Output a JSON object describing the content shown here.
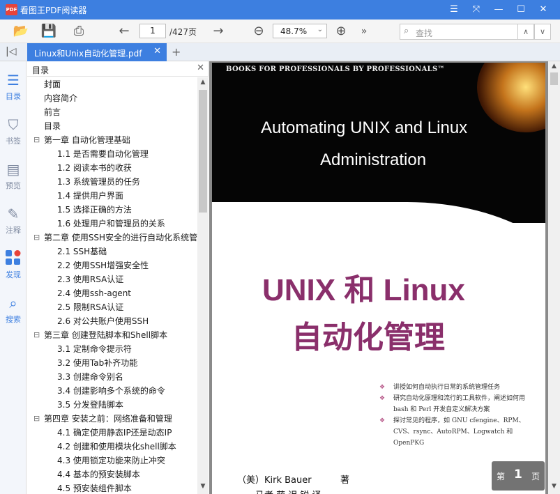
{
  "window": {
    "title": "看图王PDF阅读器",
    "logo_text": "PDF"
  },
  "toolbar": {
    "page_current": "1",
    "page_total": "/427页",
    "zoom": "48.7%",
    "search_placeholder": "查找"
  },
  "tabs": [
    {
      "label": "Linux和Unix自动化管理.pdf"
    }
  ],
  "rail": [
    {
      "label": "目录",
      "icon": "list-icon"
    },
    {
      "label": "书签",
      "icon": "bookmark-icon"
    },
    {
      "label": "预览",
      "icon": "preview-icon"
    },
    {
      "label": "注释",
      "icon": "note-icon"
    },
    {
      "label": "发现",
      "icon": "apps-icon"
    },
    {
      "label": "搜索",
      "icon": "search-icon"
    }
  ],
  "toc": {
    "title": "目录",
    "items": [
      {
        "label": "封面",
        "level": 0,
        "expandable": false
      },
      {
        "label": "内容简介",
        "level": 0,
        "expandable": false
      },
      {
        "label": "前言",
        "level": 0,
        "expandable": false
      },
      {
        "label": "目录",
        "level": 0,
        "expandable": false
      },
      {
        "label": "第一章 自动化管理基础",
        "level": 0,
        "expandable": true
      },
      {
        "label": "1.1 是否需要自动化管理",
        "level": 1,
        "expandable": false
      },
      {
        "label": "1.2 阅读本书的收获",
        "level": 1,
        "expandable": false
      },
      {
        "label": "1.3 系统管理员的任务",
        "level": 1,
        "expandable": false
      },
      {
        "label": "1.4 提供用户界面",
        "level": 1,
        "expandable": false
      },
      {
        "label": "1.5 选择正确的方法",
        "level": 1,
        "expandable": false
      },
      {
        "label": "1.6 处理用户和管理员的关系",
        "level": 1,
        "expandable": false
      },
      {
        "label": "第二章 使用SSH安全的进行自动化系统管",
        "level": 0,
        "expandable": true
      },
      {
        "label": "2.1 SSH基础",
        "level": 1,
        "expandable": false
      },
      {
        "label": "2.2 使用SSH增强安全性",
        "level": 1,
        "expandable": false
      },
      {
        "label": "2.3 使用RSA认证",
        "level": 1,
        "expandable": false
      },
      {
        "label": "2.4 使用ssh-agent",
        "level": 1,
        "expandable": false
      },
      {
        "label": "2.5 限制RSA认证",
        "level": 1,
        "expandable": false
      },
      {
        "label": "2.6 对公共账户使用SSH",
        "level": 1,
        "expandable": false
      },
      {
        "label": "第三章 创建登陆脚本和Shell脚本",
        "level": 0,
        "expandable": true
      },
      {
        "label": "3.1 定制命令提示符",
        "level": 1,
        "expandable": false
      },
      {
        "label": "3.2 使用Tab补齐功能",
        "level": 1,
        "expandable": false
      },
      {
        "label": "3.3 创建命令别名",
        "level": 1,
        "expandable": false
      },
      {
        "label": "3.4 创建影响多个系统的命令",
        "level": 1,
        "expandable": false
      },
      {
        "label": "3.5 分发登陆脚本",
        "level": 1,
        "expandable": false
      },
      {
        "label": "第四章 安装之前：网络准备和管理",
        "level": 0,
        "expandable": true
      },
      {
        "label": "4.1 确定使用静态IP还是动态IP",
        "level": 1,
        "expandable": false
      },
      {
        "label": "4.2 创建和使用模块化shell脚本",
        "level": 1,
        "expandable": false
      },
      {
        "label": "4.3 使用锁定功能来防止冲突",
        "level": 1,
        "expandable": false
      },
      {
        "label": "4.4 基本的预安装脚本",
        "level": 1,
        "expandable": false
      },
      {
        "label": "4.5 预安装组件脚本",
        "level": 1,
        "expandable": false
      }
    ]
  },
  "cover": {
    "series": "BOOKS FOR PROFESSIONALS BY PROFESSIONALS™",
    "en_title_line1": "Automating UNIX and Linux",
    "en_title_line2": "Administration",
    "cn_title_line1": "UNIX 和 Linux",
    "cn_title_line2": "自动化管理",
    "bullets": [
      "讲授如何自动执行日常的系统管理任务",
      "研究自动化原理和流行的工具软件，阐述如何用 bash 和 Perl 开发自定义解决方案",
      "探讨常见的程序，如 GNU cfengine、RPM、CVS、rsync、AutoRPM、Logwatch 和 OpenPKG"
    ],
    "author": "（美）Kirk Bauer",
    "author_role": "著",
    "translator": "马者 萌    迟    锐    译"
  },
  "page_badge": {
    "prefix": "第",
    "number": "1",
    "suffix": "页"
  }
}
